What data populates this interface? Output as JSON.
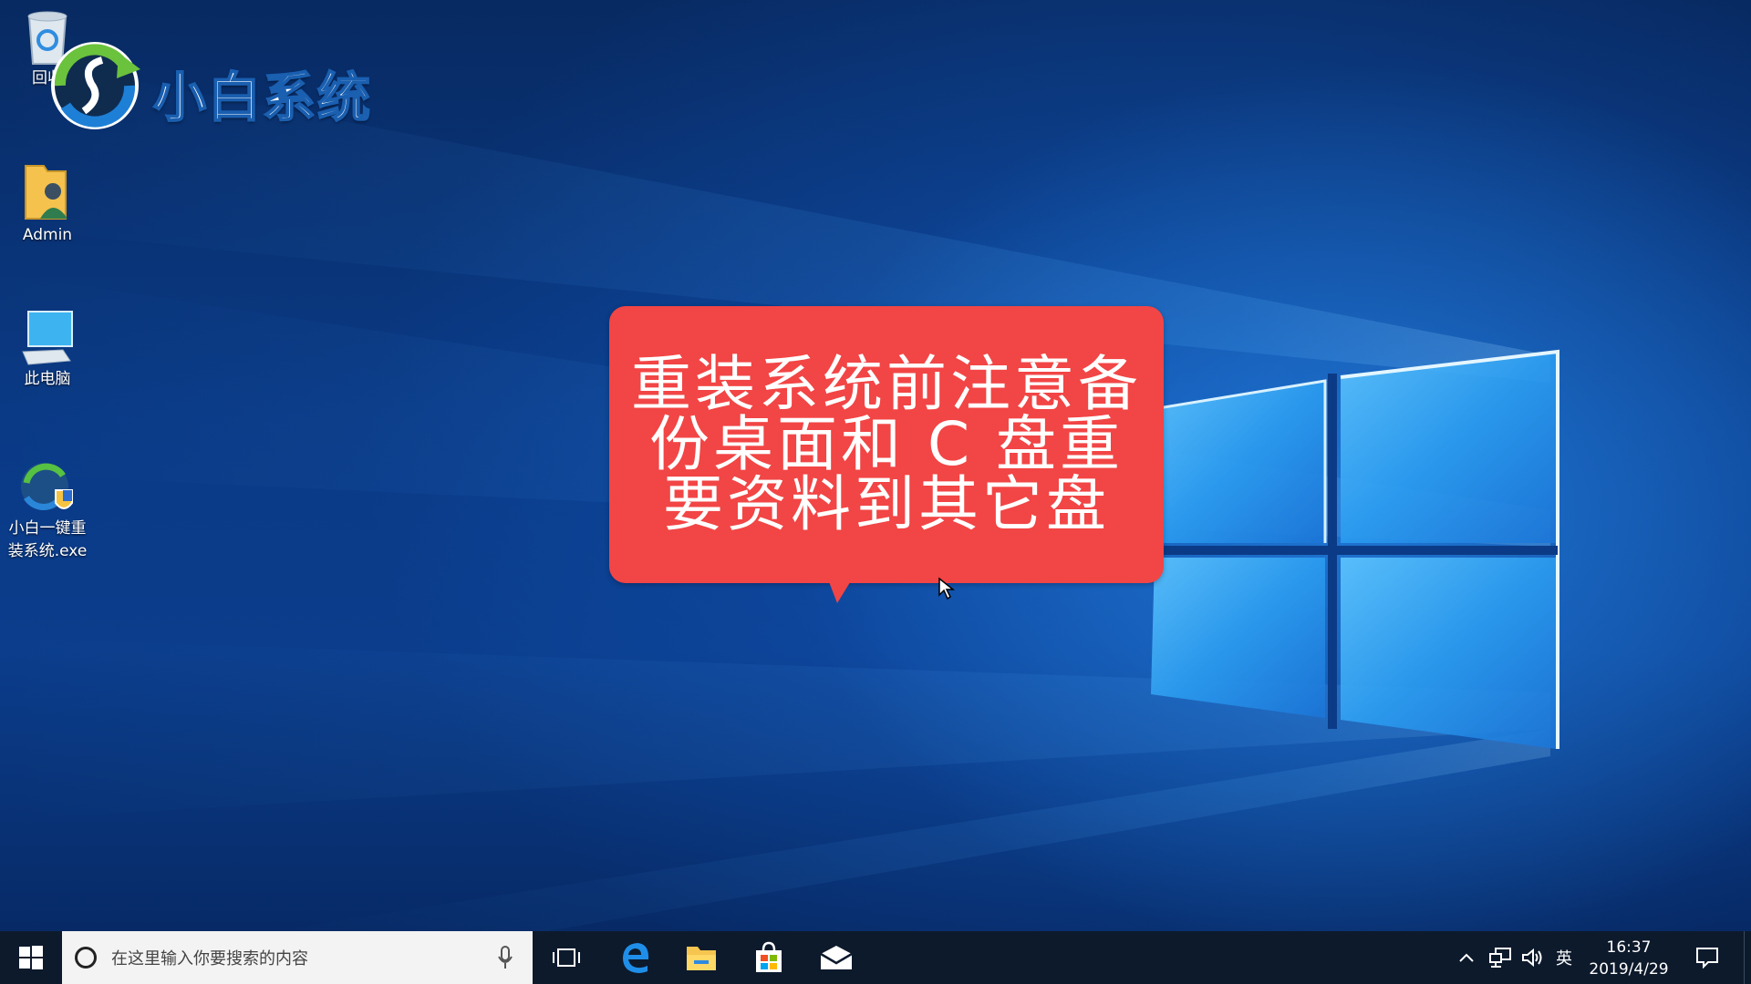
{
  "desktop": {
    "icons": [
      {
        "label": "回收",
        "icon": "recycle-bin-icon"
      },
      {
        "label": "Admin",
        "icon": "user-folder-icon"
      },
      {
        "label": "此电脑",
        "icon": "this-pc-icon"
      },
      {
        "label": "小白一键重\n装系统.exe",
        "icon": "xiaobai-installer-icon"
      }
    ]
  },
  "watermark": {
    "brand_text": "小白系统"
  },
  "bubble": {
    "line1": "重装系统前注意备",
    "line2": "份桌面和 C 盘重",
    "line3": "要资料到其它盘",
    "color": "#f24545"
  },
  "taskbar": {
    "search_placeholder": "在这里输入你要搜索的内容",
    "apps": [
      "task-view-icon",
      "edge-icon",
      "file-explorer-icon",
      "store-icon",
      "mail-icon"
    ],
    "tray": {
      "ime": "英",
      "time": "16:37",
      "date": "2019/4/29"
    }
  },
  "colors": {
    "taskbar": "#0d1a2c",
    "desktop": "#0a3a86",
    "bubble": "#f24545"
  }
}
